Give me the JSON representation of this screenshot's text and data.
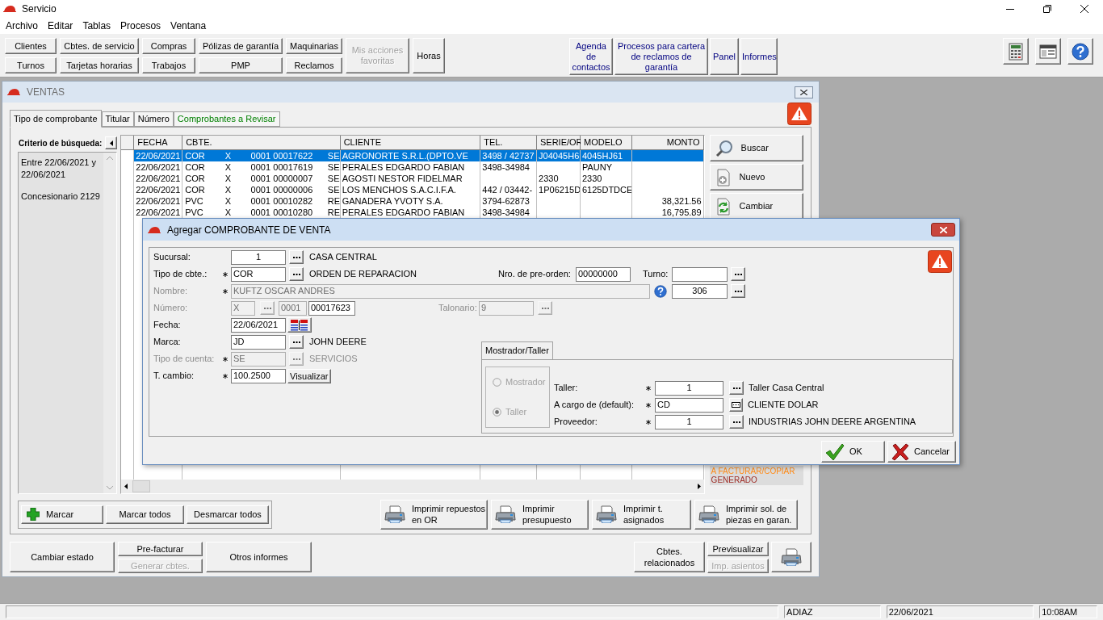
{
  "app": {
    "title": "Servicio"
  },
  "menu": [
    {
      "label": "Archivo"
    },
    {
      "label": "Editar"
    },
    {
      "label": "Tablas"
    },
    {
      "label": "Procesos"
    },
    {
      "label": "Ventana"
    }
  ],
  "toolbar": {
    "left": [
      {
        "buttons": [
          {
            "label": "Clientes",
            "disabled": false
          },
          {
            "label": "Turnos",
            "disabled": false
          }
        ]
      },
      {
        "buttons": [
          {
            "label": "Cbtes. de servicio",
            "disabled": false
          },
          {
            "label": "Tarjetas horarias",
            "disabled": false
          }
        ]
      },
      {
        "buttons": [
          {
            "label": "Compras",
            "disabled": false
          },
          {
            "label": "Trabajos",
            "disabled": false
          }
        ]
      },
      {
        "buttons": [
          {
            "label": "Pólizas de garantía",
            "disabled": false
          },
          {
            "label": "PMP",
            "disabled": false
          }
        ]
      },
      {
        "buttons": [
          {
            "label": "Maquinarias",
            "disabled": false
          },
          {
            "label": "Reclamos",
            "disabled": false
          }
        ]
      },
      {
        "buttons": [
          {
            "label": "Mis acciones favoritas",
            "disabled": true
          }
        ]
      },
      {
        "buttons": [
          {
            "label": "Horas",
            "disabled": false
          }
        ]
      }
    ],
    "right": [
      {
        "label": "Agenda de contactos"
      },
      {
        "label": "Procesos para cartera de reclamos de garantía"
      },
      {
        "label": "Panel"
      },
      {
        "label": "Informes"
      }
    ],
    "tools": [
      {
        "kind": "calculator"
      },
      {
        "kind": "window"
      },
      {
        "kind": "help"
      }
    ]
  },
  "ventas": {
    "title": "VENTAS",
    "tabs": [
      {
        "label": "Tipo de comprobante",
        "selected": true,
        "kind": "normal"
      },
      {
        "label": "Titular",
        "selected": false,
        "kind": "normal"
      },
      {
        "label": "Número",
        "selected": false,
        "kind": "normal"
      },
      {
        "label": "Comprobantes a Revisar",
        "selected": false,
        "kind": "review"
      }
    ],
    "criteria": {
      "title": "Criterio de búsqueda:",
      "lines": [
        "Entre 22/06/2021 y 22/06/2021",
        "Concesionario 2129"
      ]
    },
    "table": {
      "columns": [
        "FECHA",
        "CBTE.",
        "CLIENTE",
        "TEL.",
        "SERIE/OR",
        "MODELO",
        "MONTO"
      ],
      "rows": [
        {
          "selected": true,
          "fecha": "22/06/2021",
          "cbte": [
            "COR",
            "X",
            "0001",
            "00017622",
            "SE"
          ],
          "cliente": "AGRONORTE S.R.L.(DPTO.VE",
          "tel": "3498 / 42737",
          "serie": "J04045H6",
          "modelo": "4045HJ61"
        },
        {
          "selected": false,
          "fecha": "22/06/2021",
          "cbte": [
            "COR",
            "X",
            "0001",
            "00017619",
            "SE"
          ],
          "cliente": "PERALES EDGARDO FABIAN",
          "tel": "3498-34984",
          "modelo": "PAUNY"
        },
        {
          "selected": false,
          "fecha": "22/06/2021",
          "cbte": [
            "COR",
            "X",
            "0001",
            "00000007",
            "SE"
          ],
          "cliente": "AGOSTI NESTOR FIDELMAR",
          "serie": "2330",
          "modelo": "2330"
        },
        {
          "selected": false,
          "fecha": "22/06/2021",
          "cbte": [
            "COR",
            "X",
            "0001",
            "00000006",
            "SE"
          ],
          "cliente": "LOS MENCHOS S.A.C.I.F.A.",
          "tel": "442 / 03442-",
          "serie": "1P06215D",
          "modelo": "6125DTDCE"
        },
        {
          "selected": false,
          "fecha": "22/06/2021",
          "cbte": [
            "PVC",
            "X",
            "0001",
            "00010282",
            "RE"
          ],
          "cliente": "GANADERA YVOTY S.A.",
          "tel": "3794-62873",
          "monto": "38,321.56"
        },
        {
          "selected": false,
          "fecha": "22/06/2021",
          "cbte": [
            "PVC",
            "X",
            "0001",
            "00010280",
            "RE"
          ],
          "cliente": "PERALES EDGARDO FABIAN",
          "tel": "3498-34984",
          "monto": "16,795.89"
        }
      ]
    },
    "actions": [
      {
        "label": "Buscar",
        "kind": "search"
      },
      {
        "label": "Nuevo",
        "kind": "new"
      },
      {
        "label": "Cambiar",
        "kind": "change"
      }
    ],
    "legend": [
      {
        "label": "A FACTURAR/COPIAR",
        "color": "#ff8c1a"
      },
      {
        "label": "GENERADO",
        "color": "#a0302a"
      }
    ],
    "mark_buttons": [
      {
        "label": "Marcar",
        "kind": "add"
      },
      {
        "label": "Marcar todos",
        "kind": "plain"
      },
      {
        "label": "Desmarcar todos",
        "kind": "plain"
      }
    ],
    "print_buttons": [
      {
        "label": "Imprimir repuestos en OR"
      },
      {
        "label": "Imprimir presupuesto"
      },
      {
        "label": "Imprimir t. asignados"
      },
      {
        "label": "Imprimir sol. de piezas en garan."
      }
    ],
    "footer_left": [
      {
        "buttons": [
          {
            "label": "Cambiar estado",
            "disabled": false
          }
        ]
      },
      {
        "buttons": [
          {
            "label": "Pre-facturar",
            "disabled": false
          },
          {
            "label": "Generar cbtes.",
            "disabled": true
          }
        ]
      },
      {
        "buttons": [
          {
            "label": "Otros informes",
            "disabled": false
          }
        ]
      }
    ],
    "footer_right": [
      {
        "buttons": [
          {
            "label": "Cbtes. relacionados",
            "disabled": false
          }
        ]
      },
      {
        "buttons": [
          {
            "label": "Previsualizar",
            "disabled": false
          },
          {
            "label": "Imp. asientos",
            "disabled": true
          }
        ]
      }
    ]
  },
  "dialog": {
    "title": "Agregar COMPROBANTE DE VENTA",
    "sucursal": {
      "label": "Sucursal:",
      "required": false,
      "value": "1",
      "description": "CASA CENTRAL"
    },
    "tipo": {
      "label": "Tipo de cbte.:",
      "required": true,
      "value": "COR",
      "description": "ORDEN DE REPARACION"
    },
    "pre_orden": {
      "label": "Nro. de pre-orden:",
      "value": "00000000"
    },
    "turno": {
      "label": "Turno:"
    },
    "nombre": {
      "label": "Nombre:",
      "required": true,
      "disabled": true,
      "value": "KUFTZ OSCAR ANDRES",
      "code": "306"
    },
    "numero": {
      "label": "Número:",
      "disabled": true,
      "letra": "X",
      "punto": "0001",
      "numero": "00017623"
    },
    "talonario": {
      "label": "Talonario:",
      "disabled": true,
      "value": "9"
    },
    "fecha": {
      "label": "Fecha:",
      "value": "22/06/2021"
    },
    "marca": {
      "label": "Marca:",
      "required": false,
      "disabled": false,
      "value": "JD",
      "description": "JOHN DEERE"
    },
    "tipo_cuenta": {
      "label": "Tipo de cuenta:",
      "required": true,
      "disabled": true,
      "value": "SE",
      "description": "SERVICIOS"
    },
    "cambio": {
      "label": "T. cambio:",
      "required": true,
      "value": "100.2500",
      "button": "Visualizar"
    },
    "group": {
      "tab": "Mostrador/Taller",
      "options_disabled": true,
      "options": [
        {
          "label": "Mostrador",
          "selected": false
        },
        {
          "label": "Taller",
          "selected": true
        }
      ],
      "fields": [
        {
          "label": "Taller:",
          "required": true,
          "value": "1",
          "kind": "lookup",
          "description": "Taller Casa Central"
        },
        {
          "label": "A cargo de (default):",
          "required": true,
          "value": "CD",
          "kind": "list",
          "description": "CLIENTE DOLAR"
        },
        {
          "label": "Proveedor:",
          "required": true,
          "value": "1",
          "kind": "lookup",
          "description": "INDUSTRIAS JOHN DEERE ARGENTINA"
        }
      ]
    },
    "buttons": [
      {
        "label": "OK",
        "kind": "ok"
      },
      {
        "label": "Cancelar",
        "kind": "cancel"
      }
    ]
  },
  "status_bar": [
    {
      "text": "ADIAZ"
    },
    {
      "text": "22/06/2021"
    },
    {
      "text": "10:08AM"
    }
  ]
}
